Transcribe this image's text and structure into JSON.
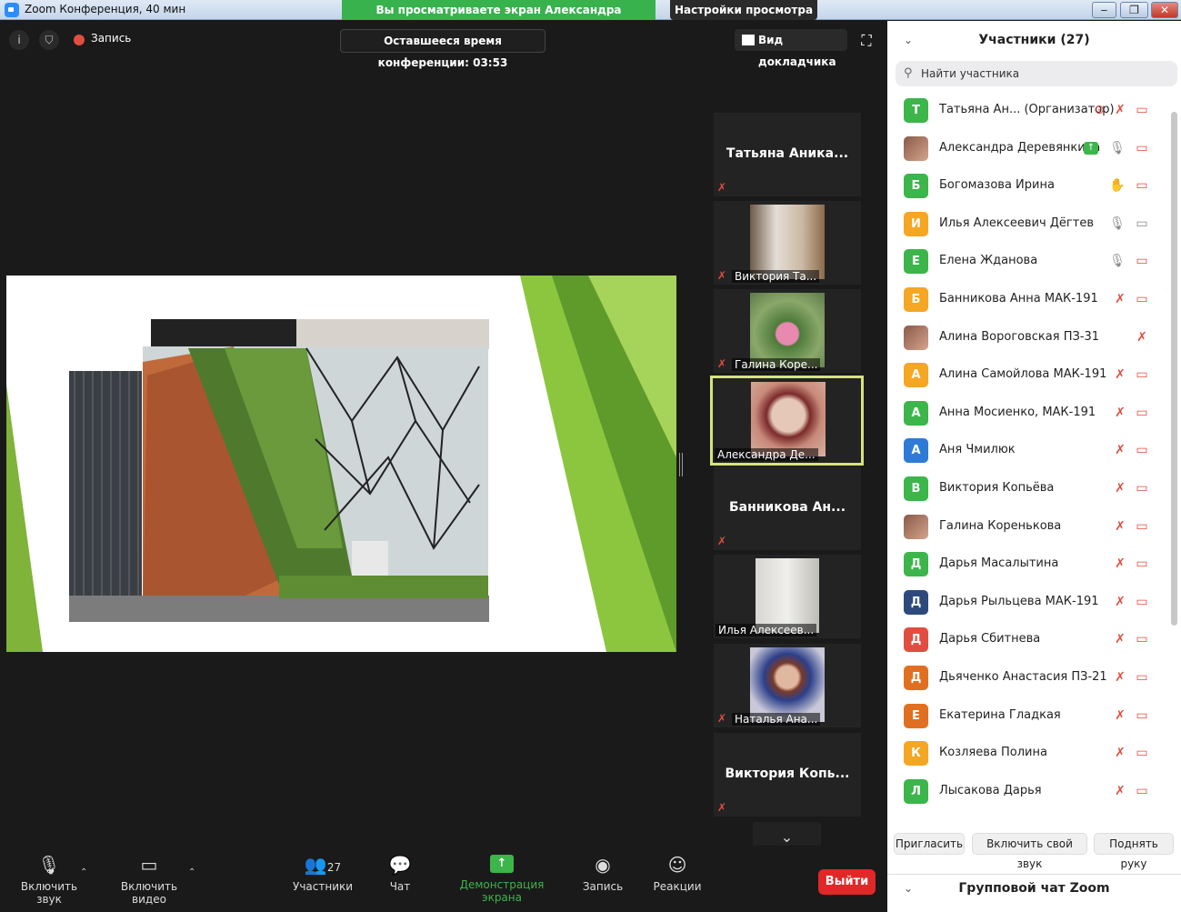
{
  "window": {
    "title": "Zoom Конференция, 40 мин",
    "share_banner": "Вы просматриваете экран Александра Деревянкина",
    "view_settings": "Настройки просмотра ⌄"
  },
  "topbar": {
    "record_label": "Запись",
    "time_left": "Оставшееся время конференции: 03:53",
    "speaker_view": "Вид докладчика"
  },
  "tiles": [
    {
      "name": "Татьяна  Аника...",
      "type": "name"
    },
    {
      "name": "Виктория Та...",
      "type": "photo"
    },
    {
      "name": "Галина Коре...",
      "type": "photo"
    },
    {
      "name": "Александра Де...",
      "type": "photo",
      "active": true
    },
    {
      "name": "Банникова  Ан...",
      "type": "name"
    },
    {
      "name": "Илья Алексеев...",
      "type": "photo"
    },
    {
      "name": "Наталья Ана...",
      "type": "photo"
    },
    {
      "name": "Виктория  Копь...",
      "type": "name"
    }
  ],
  "toolbar": {
    "unmute": "Включить звук",
    "video": "Включить видео",
    "participants": "Участники",
    "participants_count": "27",
    "chat": "Чат",
    "share": "Демонстрация экрана",
    "record": "Запись",
    "reactions": "Реакции",
    "leave": "Выйти"
  },
  "panel": {
    "title": "Участники (27)",
    "search_placeholder": "Найти участника",
    "participants": [
      {
        "initial": "Т",
        "color": "#3cb54a",
        "name": "Татьяна Ан...   (Организатор)"
      },
      {
        "initial": "",
        "color": "photo",
        "name": "Александра Деревянкина"
      },
      {
        "initial": "Б",
        "color": "#3cb54a",
        "name": "Богомазова Ирина"
      },
      {
        "initial": "И",
        "color": "#f5a623",
        "name": "Илья Алексеевич Дёгтев"
      },
      {
        "initial": "Е",
        "color": "#3cb54a",
        "name": "Елена Жданова"
      },
      {
        "initial": "Б",
        "color": "#f5a623",
        "name": " Банникова Анна МАК-191"
      },
      {
        "initial": "",
        "color": "photo",
        "name": "Алина Вороговская ПЗ-31"
      },
      {
        "initial": "А",
        "color": "#f5a623",
        "name": "Алина Самойлова МАК-191"
      },
      {
        "initial": "А",
        "color": "#3cb54a",
        "name": "Анна Мосиенко, МАК-191"
      },
      {
        "initial": "А",
        "color": "#2d7bd6",
        "name": "Аня Чмилюк"
      },
      {
        "initial": "В",
        "color": "#3cb54a",
        "name": "Виктория Копьёва"
      },
      {
        "initial": "",
        "color": "photo",
        "name": "Галина Коренькова"
      },
      {
        "initial": "Д",
        "color": "#3cb54a",
        "name": "Дарья Масалытина"
      },
      {
        "initial": "Д",
        "color": "#2e4a7d",
        "name": "Дарья Рыльцева МАК-191"
      },
      {
        "initial": "Д",
        "color": "#e04e3f",
        "name": "Дарья Сбитнева"
      },
      {
        "initial": "Д",
        "color": "#e07020",
        "name": "Дьяченко Анастасия ПЗ-21"
      },
      {
        "initial": "Е",
        "color": "#e07020",
        "name": "Екатерина Гладкая"
      },
      {
        "initial": "К",
        "color": "#f5a623",
        "name": "Козляева Полина"
      },
      {
        "initial": "Л",
        "color": "#3cb54a",
        "name": "Лысакова Дарья"
      }
    ],
    "invite": "Пригласить",
    "unmute_me": "Включить свой звук",
    "raise_hand": "Поднять руку",
    "chat_title": "Групповой чат Zoom"
  },
  "icons": {
    "info": "info-icon",
    "security": "shield-icon",
    "mic_muted": "mic-muted-icon",
    "video_off": "video-off-icon"
  }
}
